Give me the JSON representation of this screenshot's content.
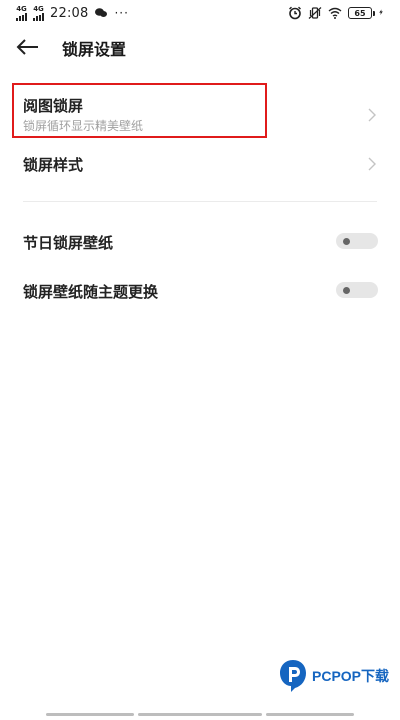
{
  "status_bar": {
    "sim1_label": "4G",
    "sim2_label": "4G",
    "time": "22:08",
    "battery_level": "65",
    "more_dots": "···"
  },
  "header": {
    "title": "锁屏设置"
  },
  "items": [
    {
      "title": "阅图锁屏",
      "subtitle": "锁屏循环显示精美壁纸"
    },
    {
      "title": "锁屏样式"
    }
  ],
  "toggles": [
    {
      "label": "节日锁屏壁纸",
      "on": false
    },
    {
      "label": "锁屏壁纸随主题更换",
      "on": false
    }
  ],
  "watermark": {
    "text": "PCPOP下载"
  },
  "colors": {
    "highlight": "#e01b1b",
    "subtitle": "#a0a0a0",
    "watermark": "#1565c0"
  }
}
